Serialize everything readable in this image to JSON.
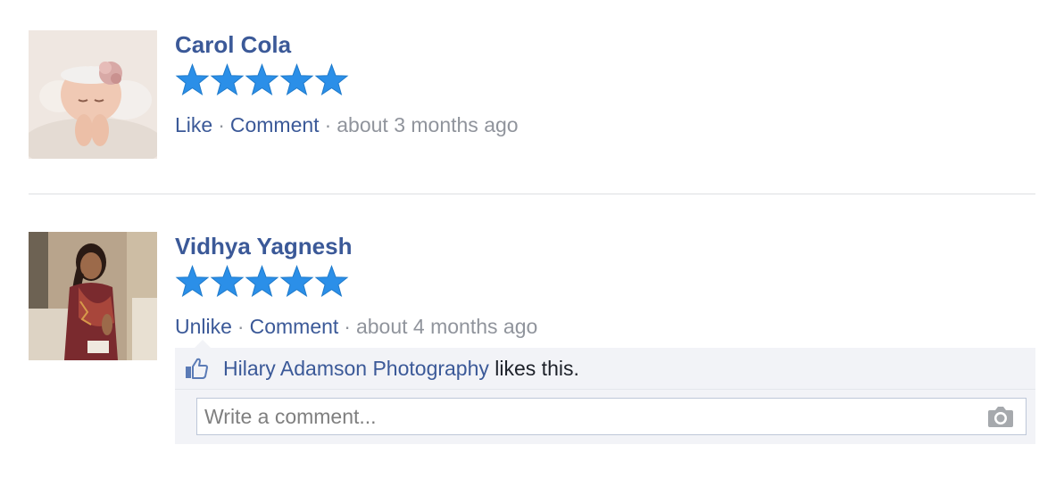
{
  "reviews": [
    {
      "name": "Carol Cola",
      "rating": 5,
      "actions": {
        "like": "Like",
        "comment": "Comment",
        "separator": "·"
      },
      "time": "about 3 months ago",
      "avatar": "baby-photo"
    },
    {
      "name": "Vidhya Yagnesh",
      "rating": 5,
      "actions": {
        "like": "Unlike",
        "comment": "Comment",
        "separator": "·"
      },
      "time": "about 4 months ago",
      "avatar": "woman-in-saree-photo",
      "likes": {
        "icon": "thumbs-up-icon",
        "liker": "Hilary Adamson Photography",
        "suffix": " likes this."
      },
      "comment_box": {
        "placeholder": "Write a comment...",
        "icon": "camera-icon"
      }
    }
  ],
  "colors": {
    "link": "#3b5998",
    "meta": "#90949c",
    "star": "#2b8fe8",
    "like_box_bg": "#f2f3f7"
  }
}
